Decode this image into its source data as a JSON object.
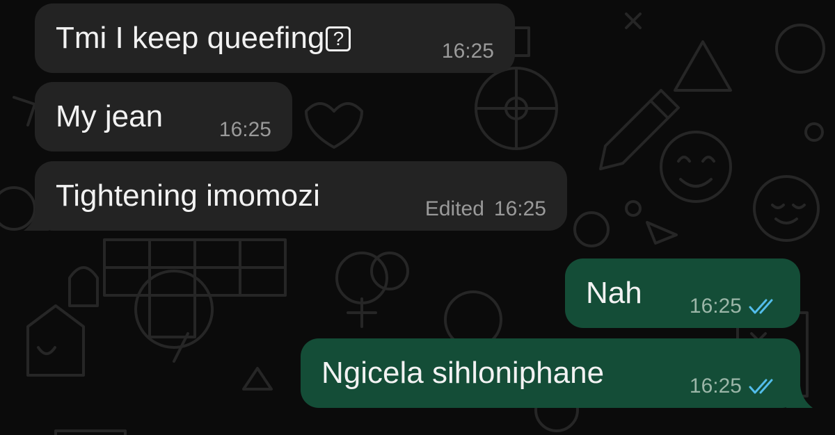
{
  "chat": {
    "messages": [
      {
        "direction": "incoming",
        "text": "Tmi I keep queefing",
        "glyph": "?",
        "time": "16:25"
      },
      {
        "direction": "incoming",
        "text": "My jean",
        "time": "16:25"
      },
      {
        "direction": "incoming",
        "text": "Tightening imomozi",
        "edited_label": "Edited",
        "time": "16:25"
      },
      {
        "direction": "outgoing",
        "text": "Nah",
        "time": "16:25",
        "status": "read"
      },
      {
        "direction": "outgoing",
        "text": "Ngicela sihloniphane",
        "time": "16:25",
        "status": "read"
      }
    ]
  },
  "theme": {
    "background": "#0b0b0b",
    "incoming_bubble": "#232323",
    "outgoing_bubble": "#144d37",
    "read_ticks": "#53bdeb",
    "text": "#f2f2f2",
    "meta_text": "#9a9a9a"
  },
  "icons": [
    "double-check-icon",
    "missing-glyph-icon",
    "doodle-wallpaper"
  ]
}
